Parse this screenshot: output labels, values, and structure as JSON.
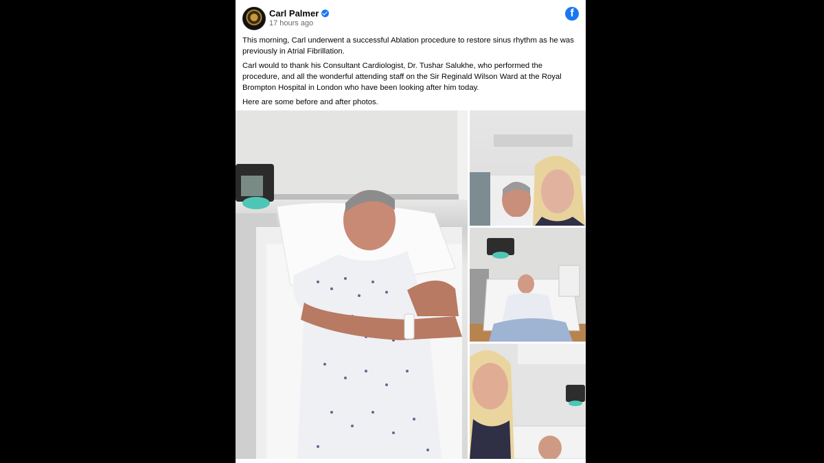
{
  "post": {
    "author": "Carl Palmer",
    "timestamp": "17 hours ago",
    "paragraphs": [
      "This morning, Carl underwent a successful Ablation procedure to restore sinus rhythm as he was previously in Atrial Fibrillation.",
      "Carl would to thank his Consultant Cardiologist, Dr. Tushar Salukhe, who performed the procedure, and all the wonderful attending staff on the Sir Reginald Wilson Ward at the Royal Brompton Hospital in London who have been looking after him today.",
      "Here are some before and after photos."
    ],
    "brand_icon": "facebook-icon",
    "brand_color": "#1877f2"
  },
  "photos": {
    "main": "hospital-bed-photo",
    "side": [
      "selfie-photo",
      "ward-bed-photo",
      "selfie-bed-photo"
    ]
  }
}
